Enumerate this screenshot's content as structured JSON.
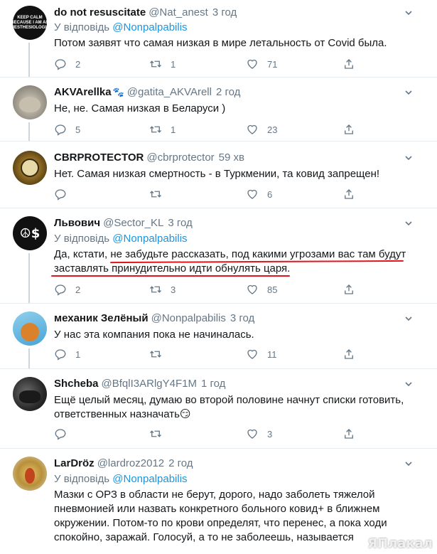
{
  "tweets": [
    {
      "name": "do not resuscitate",
      "handle": "@Nat_anest",
      "time": "3 год",
      "reply_prefix": "У відповідь",
      "reply_to": "@Nonpalpabilis",
      "text": "Потом заявят что самая низкая в мире  летальность от Covid была.",
      "replies": "2",
      "retweets": "1",
      "likes": "71",
      "avatar_text": "KEEP CALM BECAUSE I AM AN ANESTHESIOLOGIST"
    },
    {
      "name": "AKVArellka",
      "handle": "@gatita_AKVArell",
      "time": "2 год",
      "text": "Не, не. Самая низкая в Беларуси )",
      "replies": "5",
      "retweets": "1",
      "likes": "23"
    },
    {
      "name": "CBRPROTECTOR",
      "handle": "@cbrprotector",
      "time": "59 хв",
      "text": "Нет. Самая низкая смертность - в Туркмении, та ковид запрещен!",
      "replies": "",
      "retweets": "",
      "likes": "6"
    },
    {
      "name": "Львович",
      "handle": "@Sector_KL",
      "time": "3 год",
      "reply_prefix": "У відповідь",
      "reply_to": "@Nonpalpabilis",
      "text_line1": "Да, кстати, не забудьте рассказать, под какими угрозами вас там будут",
      "text_line2": "заставлять принудительно идти обнулять царя.",
      "replies": "2",
      "retweets": "3",
      "likes": "85"
    },
    {
      "name": "механик Зелёный",
      "handle": "@Nonpalpabilis",
      "time": "3 год",
      "text": "У нас эта компания пока не начиналась.",
      "replies": "1",
      "retweets": "",
      "likes": "11"
    },
    {
      "name": "Shcheba",
      "handle": "@BfqlI3ARlgY4F1M",
      "time": "1 год",
      "text": "Ещё целый месяц, думаю во второй половине начнут списки готовить, ответственных назначать😏",
      "replies": "",
      "retweets": "",
      "likes": "3"
    },
    {
      "name": "LarDröz",
      "handle": "@lardroz2012",
      "time": "2 год",
      "reply_prefix": "У відповідь",
      "reply_to": "@Nonpalpabilis",
      "text": "Мазки с ОРЗ в области не берут, дорого, надо заболеть тяжелой пневмонией или назвать конкретного больного ковид+ в ближнем окружении. Потом-то по крови определят, что перенес, а пока ходи спокойно, заражай. Голосуй, а то не заболеешь, называется"
    }
  ],
  "watermark": "ЯПлакал",
  "colors": {
    "link": "#1b95e0",
    "muted": "#657786",
    "underline": "#e0161e",
    "border": "#e6ecf0"
  },
  "icons": [
    "reply-icon",
    "retweet-icon",
    "like-icon",
    "share-icon",
    "chevron-down-icon"
  ]
}
